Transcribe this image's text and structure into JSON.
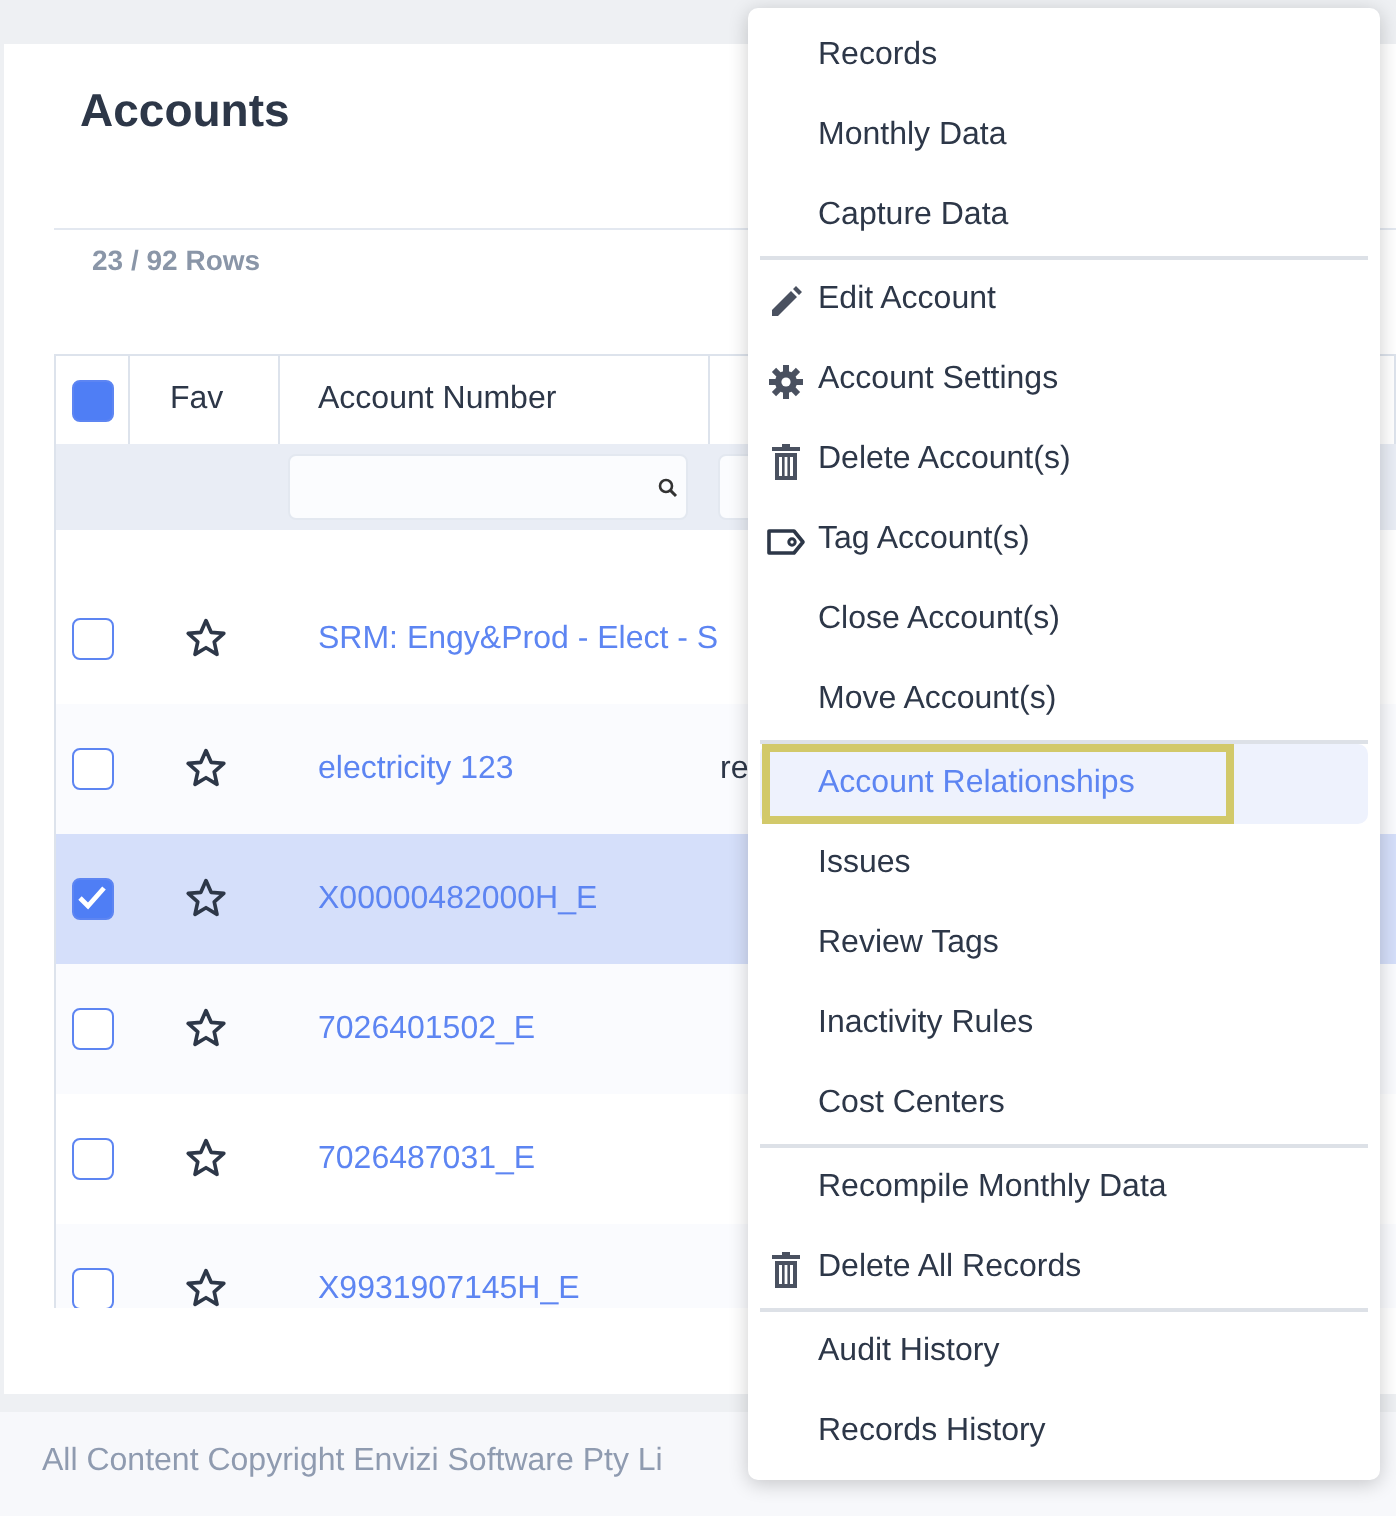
{
  "page": {
    "title": "Accounts",
    "row_count": "23 / 92 Rows"
  },
  "table": {
    "select_all": {
      "partial": true
    },
    "columns": [
      "Fav",
      "Account Number"
    ],
    "filters": [
      {
        "kind": "search"
      },
      {
        "kind": "plain"
      }
    ],
    "rows": [
      {
        "checked": false,
        "selected": false,
        "starred": false,
        "account_number": "SRM: Engy&Prod - Elect - S"
      },
      {
        "checked": false,
        "selected": false,
        "starred": false,
        "account_number": "electricity 123",
        "column_4": "re"
      },
      {
        "checked": true,
        "selected": true,
        "starred": false,
        "account_number": "X00000482000H_E"
      },
      {
        "checked": false,
        "selected": false,
        "starred": false,
        "account_number": "7026401502_E"
      },
      {
        "checked": false,
        "selected": false,
        "starred": false,
        "account_number": "7026487031_E"
      },
      {
        "checked": false,
        "selected": false,
        "starred": false,
        "account_number": "X9931907145H_E"
      }
    ]
  },
  "footer": {
    "text": "All Content Copyright Envizi Software Pty Li"
  },
  "context_menu": {
    "groups": [
      [
        {
          "label": "Records",
          "kind": "plain",
          "selected": false
        },
        {
          "label": "Monthly Data",
          "kind": "plain",
          "selected": false
        },
        {
          "label": "Capture Data",
          "kind": "plain",
          "selected": false
        }
      ],
      [
        {
          "label": "Edit Account",
          "kind": "edit",
          "selected": false
        },
        {
          "label": "Account Settings",
          "kind": "settings",
          "selected": false
        },
        {
          "label": "Delete Account(s)",
          "kind": "delete",
          "selected": false
        },
        {
          "label": "Tag Account(s)",
          "kind": "tag",
          "selected": false
        },
        {
          "label": "Close Account(s)",
          "kind": "plain",
          "selected": false
        },
        {
          "label": "Move Account(s)",
          "kind": "plain",
          "selected": false
        }
      ],
      [
        {
          "label": "Account Relationships",
          "kind": "plain",
          "selected": true
        },
        {
          "label": "Issues",
          "kind": "plain",
          "selected": false
        },
        {
          "label": "Review Tags",
          "kind": "plain",
          "selected": false
        },
        {
          "label": "Inactivity Rules",
          "kind": "plain",
          "selected": false
        },
        {
          "label": "Cost Centers",
          "kind": "plain",
          "selected": false
        }
      ],
      [
        {
          "label": "Recompile Monthly Data",
          "kind": "plain",
          "selected": false
        },
        {
          "label": "Delete All Records",
          "kind": "delete",
          "selected": false
        }
      ],
      [
        {
          "label": "Audit History",
          "kind": "plain",
          "selected": false
        },
        {
          "label": "Records History",
          "kind": "plain",
          "selected": false
        }
      ]
    ]
  }
}
